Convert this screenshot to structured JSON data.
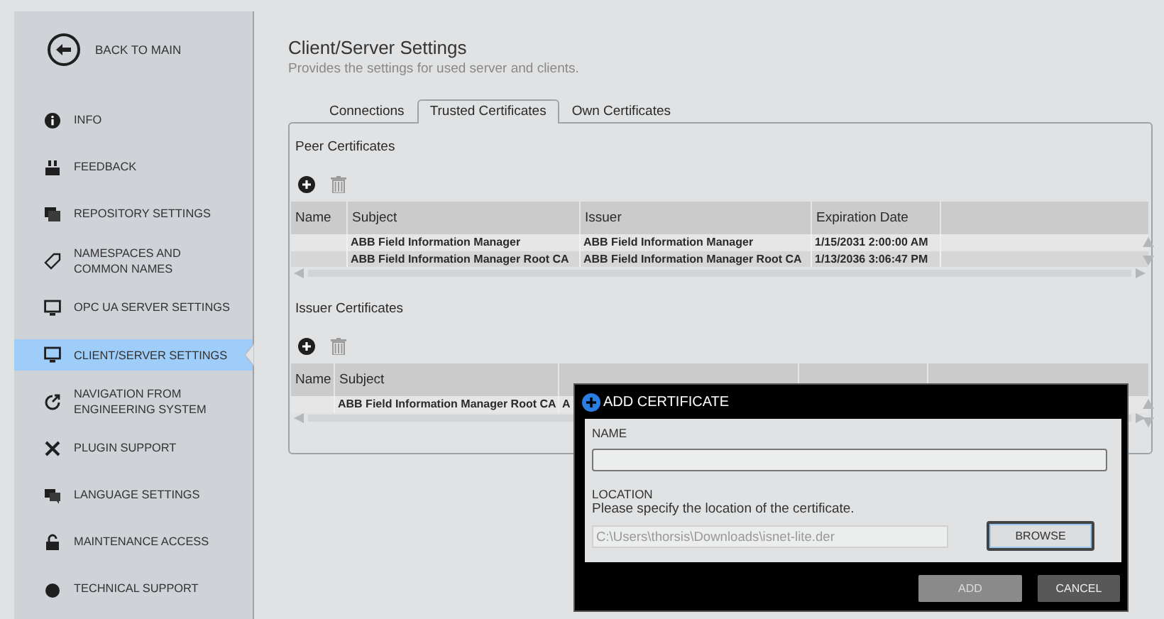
{
  "sidebar": {
    "back": "BACK TO MAIN",
    "items": [
      {
        "label": "INFO",
        "selected": false
      },
      {
        "label": "FEEDBACK",
        "selected": false
      },
      {
        "label": "REPOSITORY SETTINGS",
        "selected": false
      },
      {
        "label": "NAMESPACES AND COMMON NAMES",
        "selected": false
      },
      {
        "label": "OPC UA SERVER SETTINGS",
        "selected": false
      },
      {
        "label": "CLIENT/SERVER SETTINGS",
        "selected": true
      },
      {
        "label": "NAVIGATION FROM ENGINEERING SYSTEM",
        "selected": false
      },
      {
        "label": "PLUGIN SUPPORT",
        "selected": false
      },
      {
        "label": "LANGUAGE SETTINGS",
        "selected": false
      },
      {
        "label": "MAINTENANCE ACCESS",
        "selected": false
      },
      {
        "label": "TECHNICAL SUPPORT",
        "selected": false
      }
    ]
  },
  "page": {
    "title": "Client/Server Settings",
    "subtitle": "Provides the settings for used server and clients."
  },
  "tabs": [
    {
      "label": "Connections",
      "selected": false
    },
    {
      "label": "Trusted Certificates",
      "selected": true
    },
    {
      "label": "Own Certificates",
      "selected": false
    }
  ],
  "sections": [
    {
      "title": "Peer Certificates",
      "columns": [
        "Name",
        "Subject",
        "Issuer",
        "Expiration Date",
        ""
      ],
      "rows": [
        [
          "",
          "ABB Field Information Manager",
          "ABB Field Information Manager",
          "1/15/2031 2:00:00 AM",
          ""
        ],
        [
          "",
          "ABB Field Information Manager Root CA",
          "ABB Field Information Manager Root CA",
          "1/13/2036 3:06:47 PM",
          ""
        ]
      ]
    },
    {
      "title": "Issuer Certificates",
      "columns": [
        "Name",
        "Subject",
        "",
        "",
        ""
      ],
      "rows": [
        [
          "",
          "ABB Field Information Manager Root CA",
          "A",
          "",
          ""
        ]
      ]
    }
  ],
  "dialog": {
    "title": "ADD CERTIFICATE",
    "name_label": "NAME",
    "location_label": "LOCATION",
    "location_hint": "Please specify the location of the certificate.",
    "location_value": "C:\\Users\\thorsis\\Downloads\\isnet-lite.der",
    "browse": "BROWSE",
    "buttons": [
      {
        "label": "ADD",
        "disabled": true
      },
      {
        "label": "CANCEL",
        "disabled": false
      }
    ]
  }
}
